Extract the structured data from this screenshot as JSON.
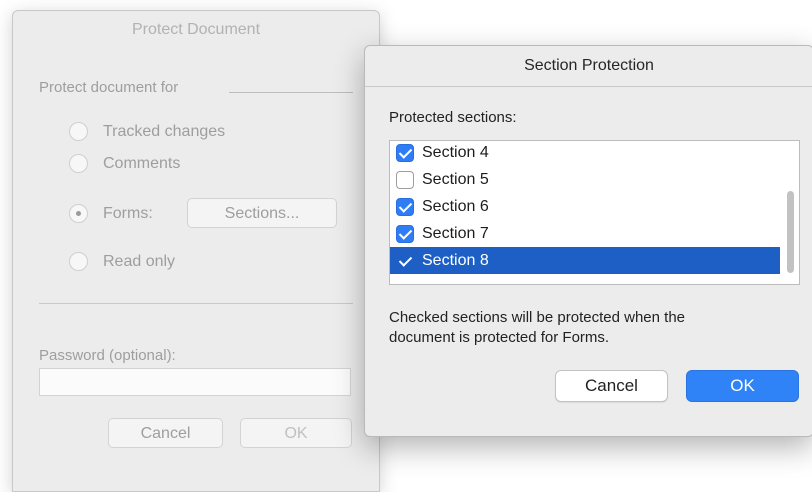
{
  "protect_dialog": {
    "title": "Protect Document",
    "section_label": "Protect document for",
    "options": [
      {
        "label": "Tracked changes",
        "selected": false
      },
      {
        "label": "Comments",
        "selected": false
      },
      {
        "label": "Forms:",
        "selected": true
      },
      {
        "label": "Read only",
        "selected": false
      }
    ],
    "sections_button": "Sections...",
    "password_label": "Password (optional):",
    "password_value": "",
    "cancel_label": "Cancel",
    "ok_label": "OK"
  },
  "section_dialog": {
    "title": "Section Protection",
    "list_label": "Protected sections:",
    "sections": [
      {
        "label": "Section 4",
        "checked": true,
        "selected": false
      },
      {
        "label": "Section 5",
        "checked": false,
        "selected": false
      },
      {
        "label": "Section 6",
        "checked": true,
        "selected": false
      },
      {
        "label": "Section 7",
        "checked": true,
        "selected": false
      },
      {
        "label": "Section 8",
        "checked": true,
        "selected": true
      }
    ],
    "help_line1": "Checked sections will be protected when the",
    "help_line2": "document is protected for Forms.",
    "cancel_label": "Cancel",
    "ok_label": "OK"
  },
  "colors": {
    "accent": "#2f83f7",
    "selection": "#1d5fc5"
  }
}
